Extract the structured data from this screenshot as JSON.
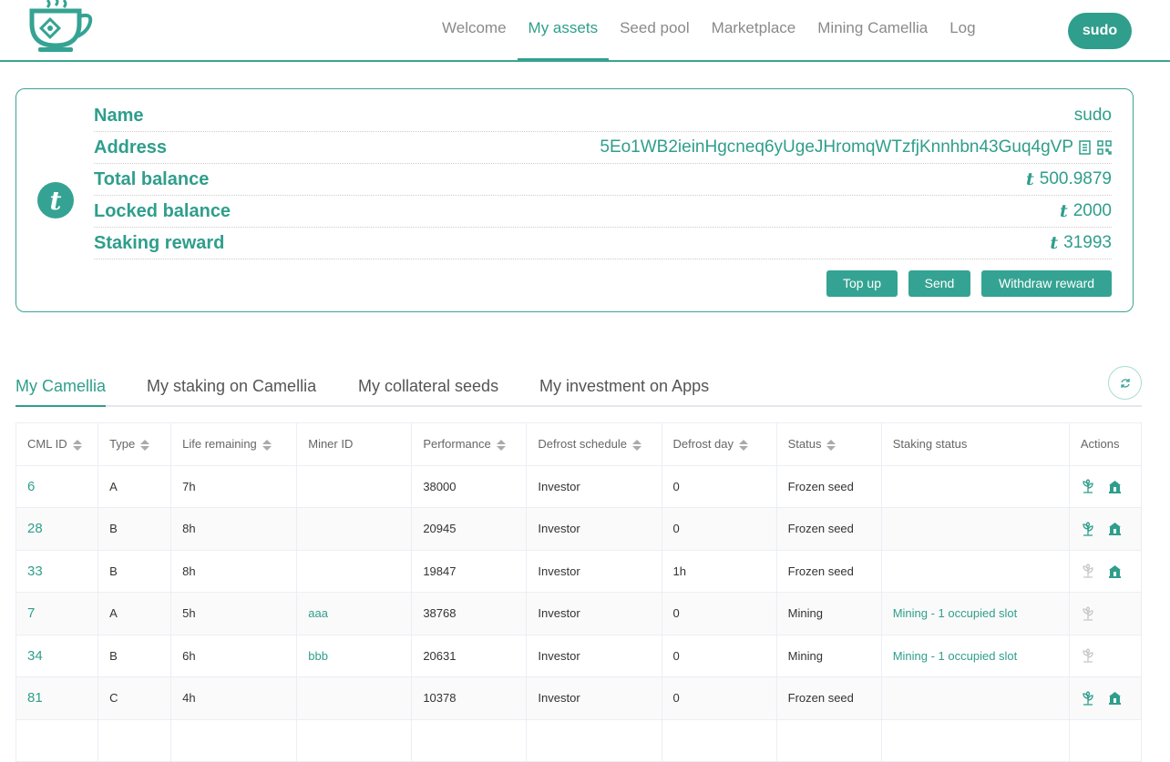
{
  "nav": {
    "items": [
      "Welcome",
      "My assets",
      "Seed pool",
      "Marketplace",
      "Mining Camellia",
      "Log"
    ],
    "active": "My assets",
    "user": "sudo"
  },
  "account": {
    "rows": [
      {
        "label": "Name",
        "value": "sudo"
      },
      {
        "label": "Address",
        "value": "5Eo1WB2ieinHgcneq6yUgeJHromqWTzfjKnnhbn43Guq4gVP"
      },
      {
        "label": "Total balance",
        "value": "500.9879"
      },
      {
        "label": "Locked balance",
        "value": "2000"
      },
      {
        "label": "Staking reward",
        "value": "31993"
      }
    ],
    "currency_symbol": "t",
    "buttons": {
      "top_up": "Top up",
      "send": "Send",
      "withdraw": "Withdraw reward"
    }
  },
  "tabs": [
    "My Camellia",
    "My staking on Camellia",
    "My collateral seeds",
    "My investment on Apps"
  ],
  "table": {
    "columns": [
      "CML ID",
      "Type",
      "Life remaining",
      "Miner ID",
      "Performance",
      "Defrost schedule",
      "Defrost day",
      "Status",
      "Staking status",
      "Actions"
    ],
    "rows": [
      {
        "id": "6",
        "type": "A",
        "life": "7h",
        "miner": "",
        "perf": "38000",
        "schedule": "Investor",
        "day": "0",
        "status": "Frozen seed",
        "staking": "",
        "plant": true,
        "stake": true
      },
      {
        "id": "28",
        "type": "B",
        "life": "8h",
        "miner": "",
        "perf": "20945",
        "schedule": "Investor",
        "day": "0",
        "status": "Frozen seed",
        "staking": "",
        "plant": true,
        "stake": true
      },
      {
        "id": "33",
        "type": "B",
        "life": "8h",
        "miner": "",
        "perf": "19847",
        "schedule": "Investor",
        "day": "1h",
        "status": "Frozen seed",
        "staking": "",
        "plant": false,
        "stake": true
      },
      {
        "id": "7",
        "type": "A",
        "life": "5h",
        "miner": "aaa",
        "perf": "38768",
        "schedule": "Investor",
        "day": "0",
        "status": "Mining",
        "staking": "Mining - 1 occupied slot",
        "plant": false,
        "stake": false
      },
      {
        "id": "34",
        "type": "B",
        "life": "6h",
        "miner": "bbb",
        "perf": "20631",
        "schedule": "Investor",
        "day": "0",
        "status": "Mining",
        "staking": "Mining - 1 occupied slot",
        "plant": false,
        "stake": false
      },
      {
        "id": "81",
        "type": "C",
        "life": "4h",
        "miner": "",
        "perf": "10378",
        "schedule": "Investor",
        "day": "0",
        "status": "Frozen seed",
        "staking": "",
        "plant": true,
        "stake": true
      }
    ]
  },
  "colors": {
    "accent": "#2f9e8c",
    "disabled": "#c8c8cc"
  }
}
